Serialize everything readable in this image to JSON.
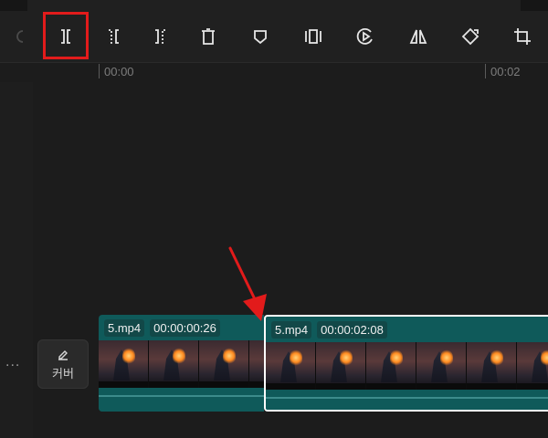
{
  "toolbar": {
    "buttons": [
      {
        "icon": "undo-icon",
        "enabled": false
      },
      {
        "icon": "split-icon",
        "enabled": true
      },
      {
        "icon": "split-left-icon",
        "enabled": true
      },
      {
        "icon": "split-right-icon",
        "enabled": true
      },
      {
        "icon": "delete-icon",
        "enabled": true
      },
      {
        "icon": "marker-icon",
        "enabled": true
      },
      {
        "icon": "freeze-frame-icon",
        "enabled": true
      },
      {
        "icon": "play-reverse-icon",
        "enabled": true
      },
      {
        "icon": "mirror-icon",
        "enabled": true
      },
      {
        "icon": "rotate-icon",
        "enabled": true
      },
      {
        "icon": "crop-icon",
        "enabled": true
      }
    ],
    "highlighted": "split-icon",
    "highlight_color": "#e21b1b"
  },
  "ruler": {
    "labels": [
      "00:00",
      "00:02"
    ]
  },
  "track": {
    "more_label": "...",
    "cover_label": "커버",
    "clips": [
      {
        "name": "5.mp4",
        "duration": "00:00:00:26",
        "selected": false
      },
      {
        "name": "5.mp4",
        "duration": "00:00:02:08",
        "selected": true
      }
    ]
  },
  "colors": {
    "clip": "#0f5a5a",
    "selection": "#ffffff",
    "annotation_arrow": "#e21b1b"
  }
}
